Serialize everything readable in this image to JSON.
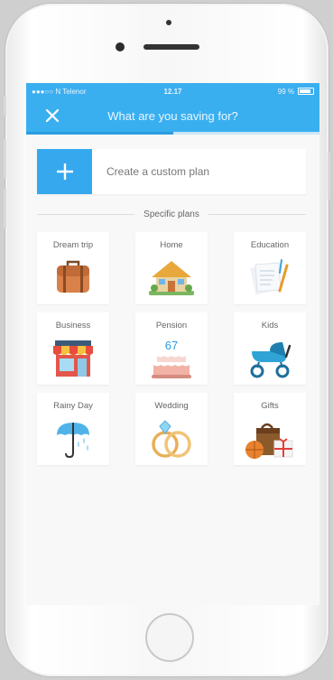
{
  "status_bar": {
    "carrier": "●●●○○ N Telenor",
    "time": "12.17",
    "battery": "99 %"
  },
  "nav": {
    "title": "What are you saving for?",
    "close_icon": "close-icon",
    "progress": 0.5
  },
  "custom_plan": {
    "label": "Create a custom plan",
    "icon": "plus-icon"
  },
  "section": {
    "title": "Specific plans"
  },
  "plans": [
    {
      "label": "Dream trip",
      "icon": "suitcase-icon"
    },
    {
      "label": "Home",
      "icon": "house-icon"
    },
    {
      "label": "Education",
      "icon": "papers-pen-icon"
    },
    {
      "label": "Business",
      "icon": "shop-icon"
    },
    {
      "label": "Pension",
      "icon": "birthday-cake-icon",
      "cake_number": "67"
    },
    {
      "label": "Kids",
      "icon": "stroller-icon"
    },
    {
      "label": "Rainy Day",
      "icon": "umbrella-icon"
    },
    {
      "label": "Wedding",
      "icon": "rings-icon"
    },
    {
      "label": "Gifts",
      "icon": "gifts-icon"
    }
  ],
  "colors": {
    "accent": "#3aaff0",
    "background": "#f8f8f8"
  }
}
